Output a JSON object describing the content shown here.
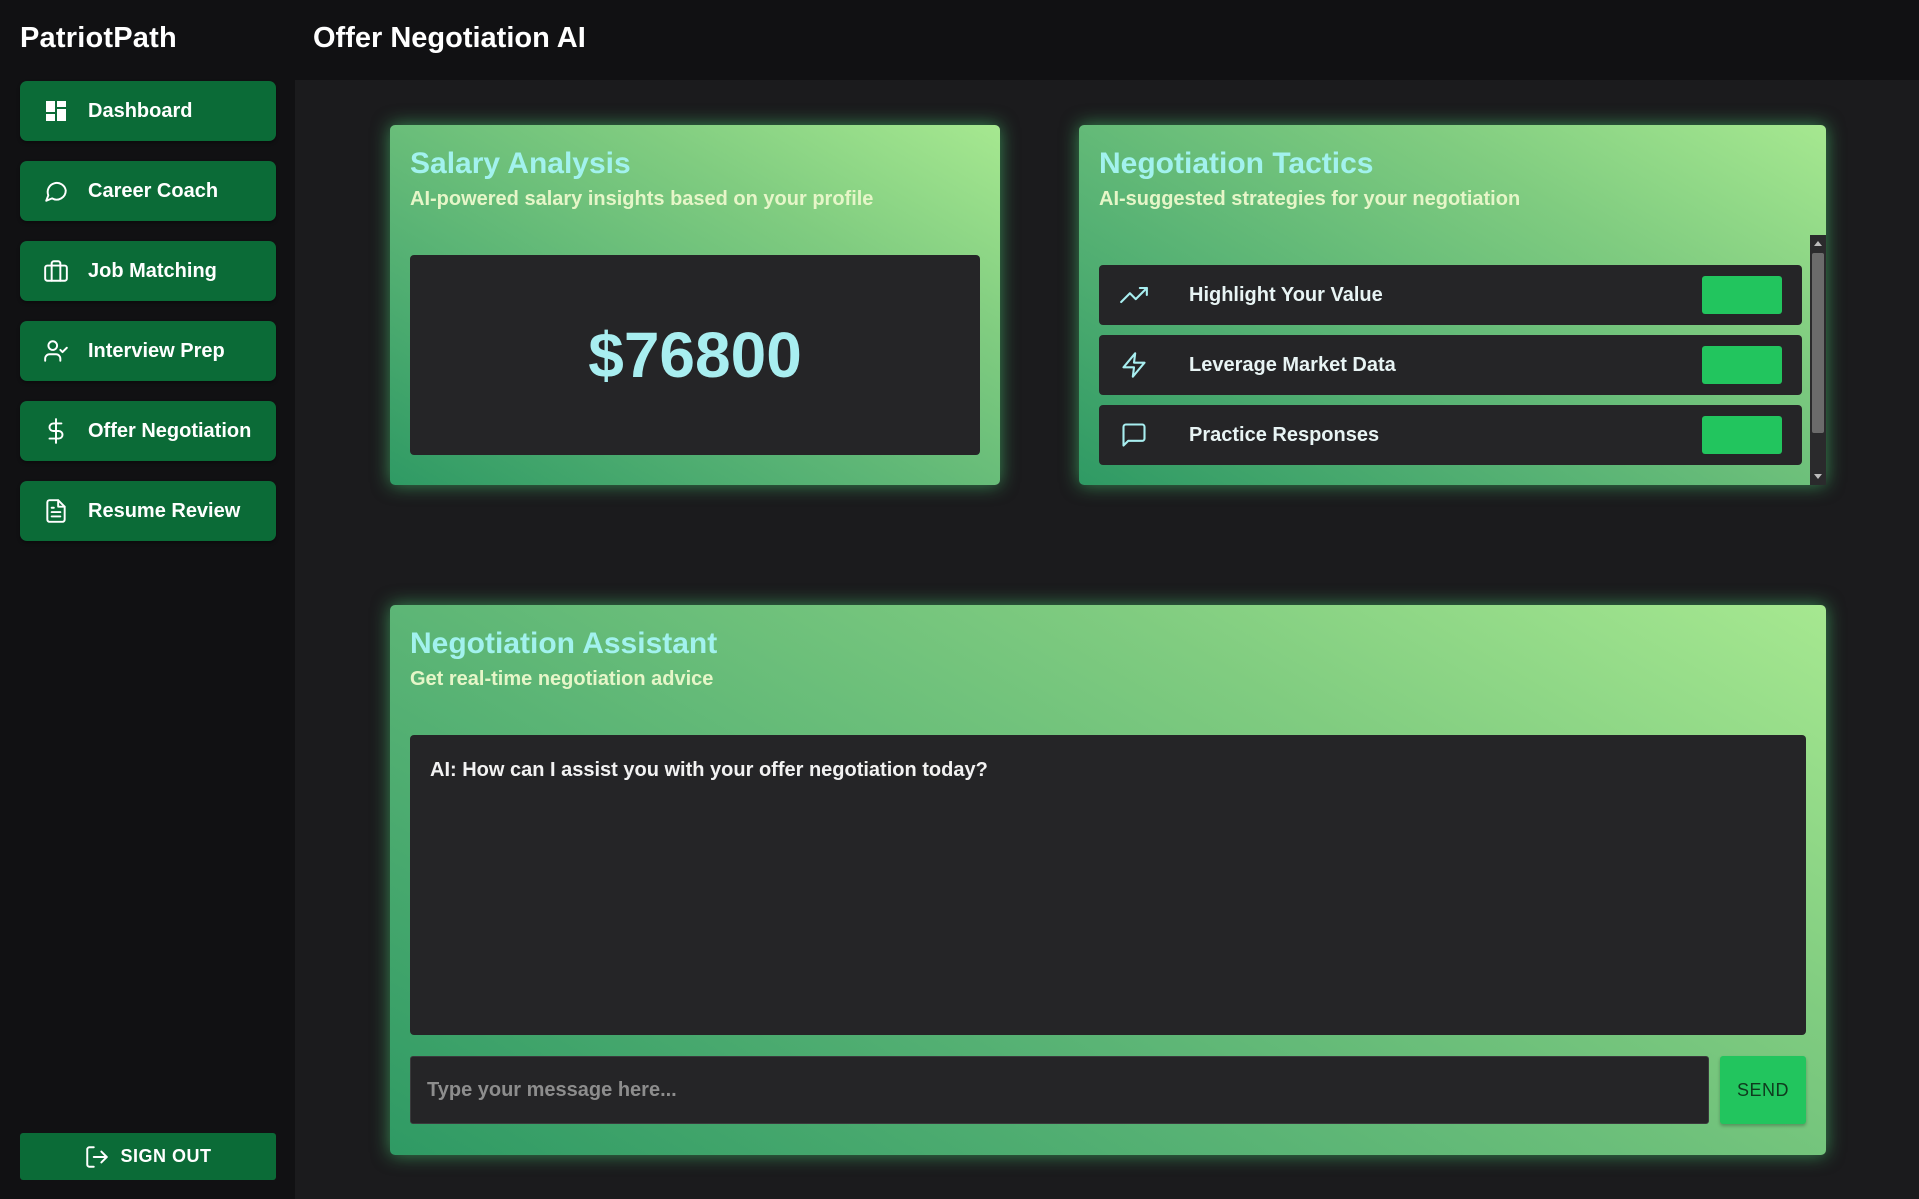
{
  "app": {
    "brand": "PatriotPath",
    "page_title": "Offer Negotiation AI"
  },
  "sidebar": {
    "items": [
      {
        "label": "Dashboard",
        "icon": "dashboard-icon"
      },
      {
        "label": "Career Coach",
        "icon": "chat-bubble-icon"
      },
      {
        "label": "Job Matching",
        "icon": "briefcase-icon"
      },
      {
        "label": "Interview Prep",
        "icon": "user-check-icon"
      },
      {
        "label": "Offer Negotiation",
        "icon": "dollar-icon"
      },
      {
        "label": "Resume Review",
        "icon": "document-icon"
      }
    ],
    "signout_label": "SIGN OUT"
  },
  "salary": {
    "title": "Salary Analysis",
    "subtitle": "AI-powered salary insights based on your profile",
    "value": "$76800"
  },
  "tactics": {
    "title": "Negotiation Tactics",
    "subtitle": "AI-suggested strategies for your negotiation",
    "items": [
      {
        "label": "Highlight Your Value",
        "icon": "trending-up-icon"
      },
      {
        "label": "Leverage Market Data",
        "icon": "lightning-icon"
      },
      {
        "label": "Practice Responses",
        "icon": "message-square-icon"
      }
    ]
  },
  "assistant": {
    "title": "Negotiation Assistant",
    "subtitle": "Get real-time negotiation advice",
    "messages": [
      {
        "text": "AI: How can I assist you with your offer negotiation today?"
      }
    ],
    "input_placeholder": "Type your message here...",
    "send_label": "SEND"
  },
  "colors": {
    "sidebar_bg": "#111113",
    "nav_green": "#0b6b37",
    "accent_green": "#22c55e",
    "title_cyan": "#a2f2ee",
    "panel_dark": "#252527"
  }
}
